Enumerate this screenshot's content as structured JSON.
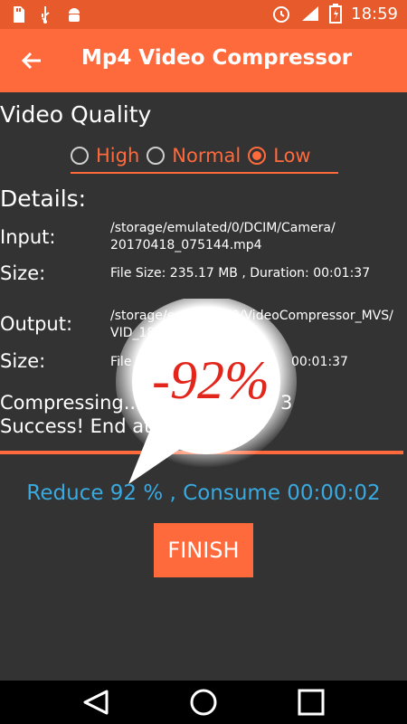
{
  "status_bar": {
    "time": "18:59"
  },
  "app_bar": {
    "title": "Mp4 Video Compressor"
  },
  "quality": {
    "title": "Video Quality",
    "options": [
      {
        "label": "High",
        "checked": false
      },
      {
        "label": "Normal",
        "checked": false
      },
      {
        "label": "Low",
        "checked": true
      }
    ]
  },
  "details": {
    "title": "Details:",
    "input_label": "Input:",
    "input_value_line1": "/storage/emulated/0/DCIM/Camera/",
    "input_value_line2": "20170418_075144.mp4",
    "size_label": "Size:",
    "input_size_value": "File Size: 235.17 MB , Duration: 00:01:37",
    "output_label": "Output:",
    "output_value_line1": "/storage/emulated/0/VideoCompressor_MVS/",
    "output_value_line2": "VID_18",
    "output_size_label": "Size:",
    "output_size_value": "File",
    "output_size_value_end": "00:01:37"
  },
  "status": {
    "compressing": "Compressing...",
    "compressing_tail": "3",
    "success": "Success! End at"
  },
  "progress": 1.0,
  "summary": "Reduce 92 % , Consume 00:00:02",
  "finish_label": "FINISH",
  "bubble_text": "-92%",
  "colors": {
    "accent": "#ff6a3d",
    "status_bar": "#e65a2c",
    "summary_text": "#39a9e0",
    "bubble_text": "#e3261b"
  }
}
